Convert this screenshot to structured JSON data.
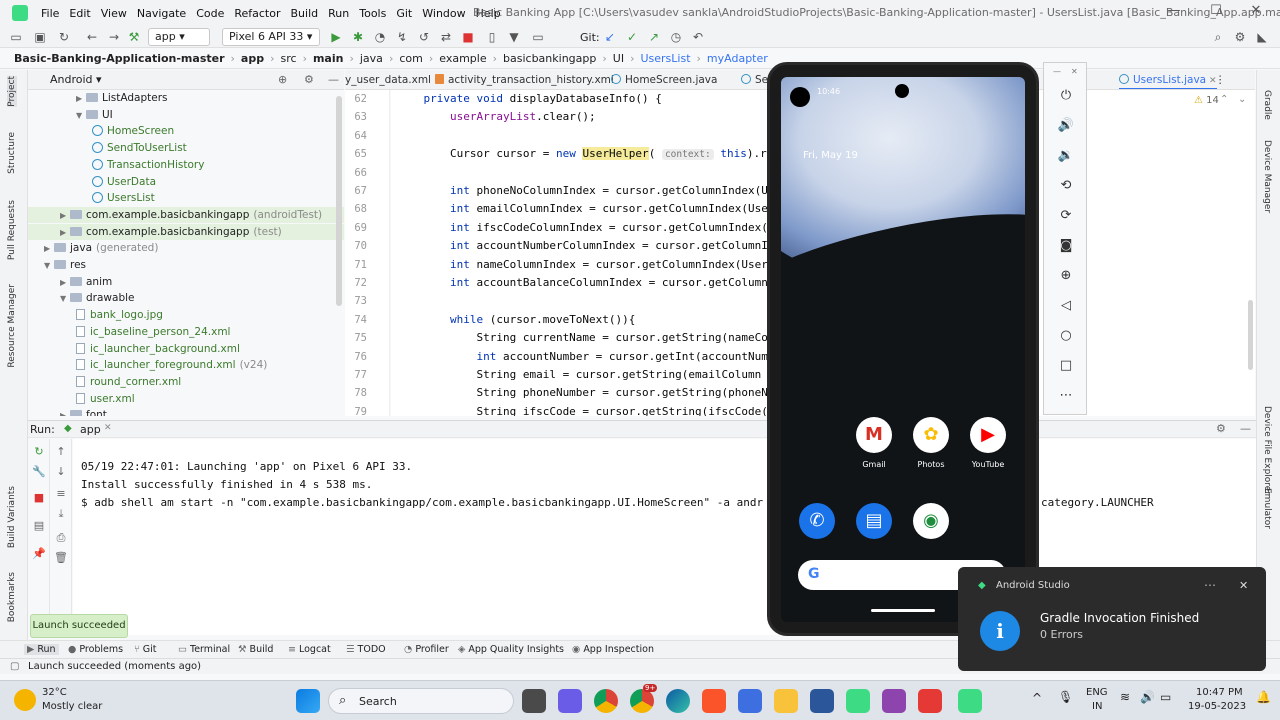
{
  "window": {
    "title": "Basic Banking App [C:\\Users\\vasudev sankla\\AndroidStudioProjects\\Basic-Banking-Application-master] - UsersList.java [Basic_Banking_App.app.main]",
    "menu": [
      "File",
      "Edit",
      "View",
      "Navigate",
      "Code",
      "Refactor",
      "Build",
      "Run",
      "Tools",
      "Git",
      "Window",
      "Help"
    ]
  },
  "toolbar": {
    "module": "app",
    "device": "Pixel 6 API 33",
    "git_label": "Git:"
  },
  "breadcrumb": [
    "Basic-Banking-Application-master",
    "app",
    "src",
    "main",
    "java",
    "com",
    "example",
    "basicbankingapp",
    "UI",
    "UsersList",
    "myAdapter"
  ],
  "project": {
    "view": "Android",
    "items": [
      {
        "label": "ListAdapters",
        "kind": "folder",
        "indent": 2
      },
      {
        "label": "UI",
        "kind": "folder",
        "indent": 2
      },
      {
        "label": "HomeScreen",
        "kind": "class",
        "indent": 3
      },
      {
        "label": "SendToUserList",
        "kind": "class",
        "indent": 3
      },
      {
        "label": "TransactionHistory",
        "kind": "class",
        "indent": 3
      },
      {
        "label": "UserData",
        "kind": "class",
        "indent": 3
      },
      {
        "label": "UsersList",
        "kind": "class",
        "indent": 3
      },
      {
        "label": "com.example.basicbankingapp",
        "suffix": "(androidTest)",
        "kind": "folder",
        "indent": 1,
        "hl": true
      },
      {
        "label": "com.example.basicbankingapp",
        "suffix": "(test)",
        "kind": "folder",
        "indent": 1,
        "hl": true
      },
      {
        "label": "java",
        "suffix": "(generated)",
        "kind": "folder",
        "indent": 0
      },
      {
        "label": "res",
        "kind": "folder",
        "indent": 0
      },
      {
        "label": "anim",
        "kind": "folder",
        "indent": 1
      },
      {
        "label": "drawable",
        "kind": "folder",
        "indent": 1
      },
      {
        "label": "bank_logo.jpg",
        "kind": "file",
        "indent": 2
      },
      {
        "label": "ic_baseline_person_24.xml",
        "kind": "file",
        "indent": 2
      },
      {
        "label": "ic_launcher_background.xml",
        "kind": "file",
        "indent": 2
      },
      {
        "label": "ic_launcher_foreground.xml",
        "suffix": "(v24)",
        "kind": "file",
        "indent": 2
      },
      {
        "label": "round_corner.xml",
        "kind": "file",
        "indent": 2
      },
      {
        "label": "user.xml",
        "kind": "file",
        "indent": 2
      },
      {
        "label": "font",
        "kind": "folder",
        "indent": 1
      }
    ]
  },
  "tabs": [
    {
      "label": "y_user_data.xml",
      "kind": "xml"
    },
    {
      "label": "activity_transaction_history.xml",
      "kind": "xml"
    },
    {
      "label": "HomeScreen.java",
      "kind": "java"
    },
    {
      "label": "Se",
      "kind": "java"
    },
    {
      "label": "UsersList.java",
      "kind": "java",
      "active": true
    }
  ],
  "editor": {
    "warnings": "14",
    "lines": [
      {
        "n": "62",
        "segs": [
          [
            "kw",
            "    private void "
          ],
          [
            "",
            "displayDatabaseInfo() {"
          ]
        ]
      },
      {
        "n": "63",
        "segs": [
          [
            "fld",
            "        userArrayList"
          ],
          [
            "",
            ".clear();"
          ]
        ]
      },
      {
        "n": "64",
        "segs": []
      },
      {
        "n": "65",
        "segs": [
          [
            "",
            "        Cursor cursor = "
          ],
          [
            "kw",
            "new "
          ],
          [
            "hlt",
            "UserHelper"
          ],
          [
            "",
            "( "
          ],
          [
            "hint",
            "context:"
          ],
          [
            "",
            " "
          ],
          [
            "kw",
            "this"
          ],
          [
            "",
            ").read"
          ]
        ]
      },
      {
        "n": "66",
        "segs": []
      },
      {
        "n": "67",
        "segs": [
          [
            "kw",
            "        int "
          ],
          [
            "",
            "phoneNoColumnIndex = cursor.getColumnIndex(U"
          ]
        ]
      },
      {
        "n": "68",
        "segs": [
          [
            "kw",
            "        int "
          ],
          [
            "",
            "emailColumnIndex = cursor.getColumnIndex(Use"
          ]
        ]
      },
      {
        "n": "69",
        "segs": [
          [
            "kw",
            "        int "
          ],
          [
            "",
            "ifscCodeColumnIndex = cursor.getColumnIndex("
          ]
        ]
      },
      {
        "n": "70",
        "segs": [
          [
            "kw",
            "        int "
          ],
          [
            "",
            "accountNumberColumnIndex = cursor.getColumnI"
          ]
        ]
      },
      {
        "n": "71",
        "segs": [
          [
            "kw",
            "        int "
          ],
          [
            "",
            "nameColumnIndex = cursor.getColumnIndex(User"
          ]
        ]
      },
      {
        "n": "72",
        "segs": [
          [
            "kw",
            "        int "
          ],
          [
            "",
            "accountBalanceColumnIndex = cursor.getColumn"
          ]
        ]
      },
      {
        "n": "73",
        "segs": []
      },
      {
        "n": "74",
        "segs": [
          [
            "kw",
            "        while "
          ],
          [
            "",
            "(cursor.moveToNext()){"
          ]
        ]
      },
      {
        "n": "75",
        "segs": [
          [
            "",
            "            String currentName = cursor.getString(nameCo"
          ]
        ]
      },
      {
        "n": "76",
        "segs": [
          [
            "kw",
            "            int "
          ],
          [
            "",
            "accountNumber = cursor.getInt(accountNum"
          ]
        ]
      },
      {
        "n": "77",
        "segs": [
          [
            "",
            "            String email = cursor.getString(emailColumn"
          ]
        ]
      },
      {
        "n": "78",
        "segs": [
          [
            "",
            "            String phoneNumber = cursor.getString(phoneN"
          ]
        ]
      },
      {
        "n": "79",
        "segs": [
          [
            "",
            "            String ifscCode = cursor.getString(ifscCode("
          ]
        ]
      }
    ]
  },
  "run": {
    "label": "Run:",
    "tab": "app",
    "console": [
      "05/19 22:47:01: Launching 'app' on Pixel 6 API 33.",
      "Install successfully finished in 4 s 538 ms.",
      "$ adb shell am start -n \"com.example.basicbankingapp/com.example.basicbankingapp.UI.HomeScreen\" -a andr"
    ],
    "console_tail": "category.LAUNCHER"
  },
  "bottom_tabs": [
    "Run",
    "Problems",
    "Git",
    "Terminal",
    "Build",
    "Logcat",
    "TODO",
    "Profiler",
    "App Quality Insights",
    "App Inspection"
  ],
  "left_strip": [
    "Project",
    "Structure",
    "Pull Requests",
    "Resource Manager",
    "Build Variants",
    "Bookmarks"
  ],
  "right_strip": [
    "Gradle",
    "Device Manager",
    "Device File Explorer",
    "Emulator"
  ],
  "launch_popup": "Launch succeeded",
  "status": "Launch succeeded (moments ago)",
  "phone": {
    "time": "10:46",
    "date": "Fri, May 19",
    "apps_row1": [
      {
        "label": "Gmail",
        "glyph": "M",
        "color": "#d93025"
      },
      {
        "label": "Photos",
        "glyph": "✿",
        "color": "#fbbc04"
      },
      {
        "label": "YouTube",
        "glyph": "▶",
        "color": "#ff0000"
      }
    ],
    "apps_row2": [
      {
        "icon": "phone-icon",
        "glyph": "✆",
        "color": "#1a73e8"
      },
      {
        "icon": "messages-icon",
        "glyph": "▤",
        "color": "#1a73e8"
      },
      {
        "icon": "chrome-icon",
        "glyph": "◉",
        "color": "#1e8e3e"
      }
    ],
    "search_glyph": "G"
  },
  "notification": {
    "app": "Android Studio",
    "title": "Gradle Invocation Finished",
    "body": "0 Errors",
    "glyph": "i"
  },
  "taskbar": {
    "weather_temp": "32°C",
    "weather_desc": "Mostly clear",
    "search": "Search",
    "lang1": "ENG",
    "lang2": "IN",
    "time": "10:47 PM",
    "date": "19-05-2023",
    "badge": "9+"
  }
}
